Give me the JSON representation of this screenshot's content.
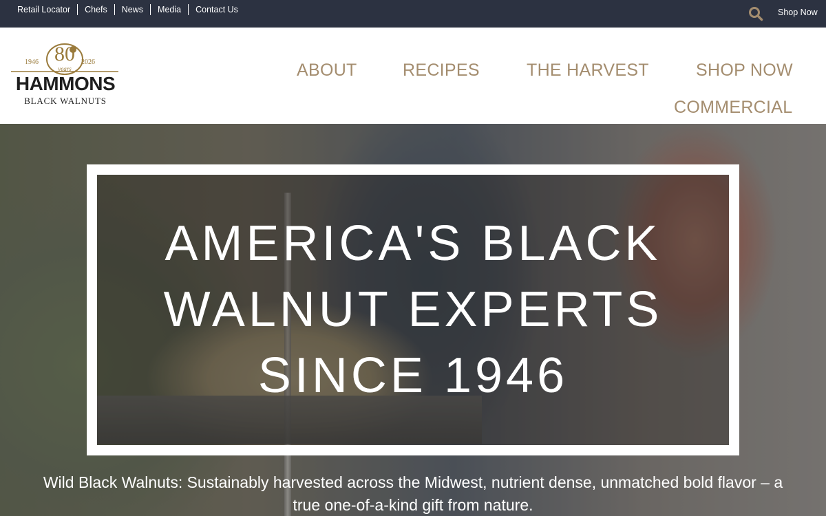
{
  "topbar": {
    "links": [
      "Retail Locator",
      "Chefs",
      "News",
      "Media",
      "Contact Us"
    ],
    "search_icon": "search-icon",
    "shop_now": "Shop Now"
  },
  "logo": {
    "year_start": "1946",
    "year_end": "2026",
    "anniversary": "80",
    "years_text": "years",
    "brand": "HAMMONS",
    "sub_brand": "BLACK WALNUTS"
  },
  "nav": {
    "about": "ABOUT",
    "recipes": "RECIPES",
    "harvest": "THE HARVEST",
    "shop": "SHOP NOW",
    "commercial": "COMMERCIAL"
  },
  "hero": {
    "title_lines": [
      "AMERICA'S BLACK",
      "WALNUT EXPERTS",
      "SINCE 1946"
    ],
    "tagline": "Wild Black Walnuts: Sustainably harvested across the Midwest, nutrient dense, unmatched bold flavor – a true one-of-a-kind gift from nature."
  },
  "colors": {
    "topbar_bg": "#2c3241",
    "nav_text": "#a48d6f",
    "logo_gold": "#9a7b3c",
    "search_icon": "#a48d6f"
  }
}
